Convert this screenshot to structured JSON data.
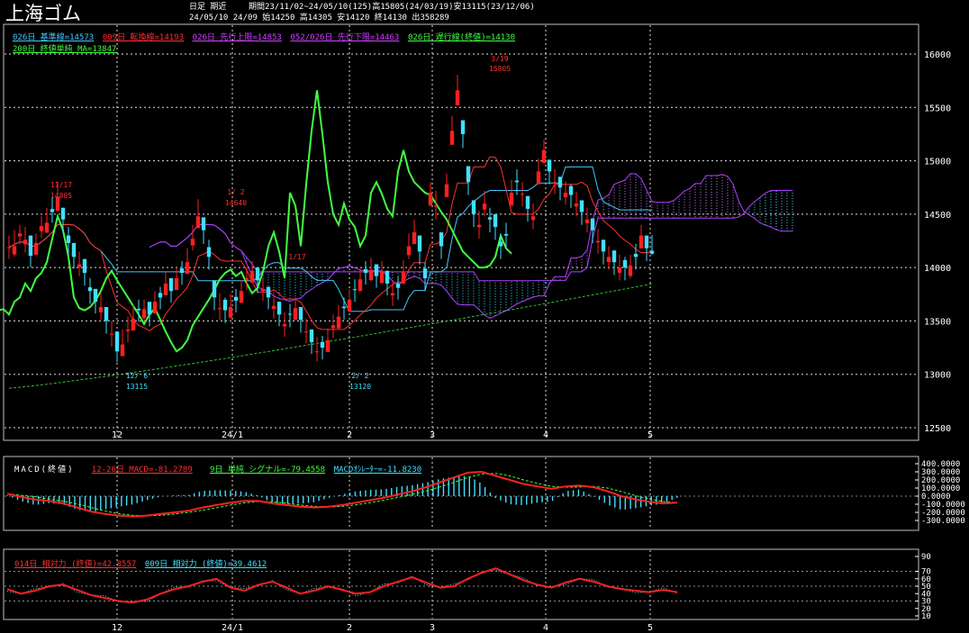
{
  "header": {
    "title": "上海ゴム",
    "mode": "日足 期近",
    "period_info": "期間23/11/02~24/05/10(125)高15805(24/03/19)安13115(23/12/06)",
    "last_bar": "24/05/10 24/09 始14250 高14305 安14120 終14130 出358289"
  },
  "legends": {
    "line1": [
      {
        "text": "026日 基準線=14573",
        "color": "#40c8ff"
      },
      {
        "text": "009日 転換線=14193",
        "color": "#ff3030"
      },
      {
        "text": "026日 先行上限=14853",
        "color": "#d040ff"
      },
      {
        "text": "052/026日 先行下限=14463",
        "color": "#d040ff"
      },
      {
        "text": "026日 遅行線(終値)=14130",
        "color": "#40ff40"
      }
    ],
    "line2": [
      {
        "text": "200日 終値単純 MA=13847",
        "color": "#40ff40"
      }
    ],
    "macd": [
      {
        "text": "MACD(終値)",
        "color": "#ffffff"
      },
      {
        "text": "12-26日 MACD=-81.2789",
        "color": "#ff3030"
      },
      {
        "text": "9日 単純 シグナル=-79.4558",
        "color": "#40ff40"
      },
      {
        "text": "MACDｵｼﾚｰﾀｰ=-11.8230",
        "color": "#40e0ff"
      }
    ],
    "rsi": [
      {
        "text": "014日 相対力 (終値)=42.8557",
        "color": "#ff3030"
      },
      {
        "text": "009日 相対力 (終値)=39.4612",
        "color": "#40e0ff"
      }
    ]
  },
  "annotations": [
    {
      "text": "11/17",
      "color": "#ff3030"
    },
    {
      "text": "14805",
      "color": "#ff3030"
    },
    {
      "text": "1/ 2",
      "color": "#ff3030"
    },
    {
      "text": "14640",
      "color": "#ff3030"
    },
    {
      "text": "1/17",
      "color": "#ff3030"
    },
    {
      "text": "3/19",
      "color": "#ff3030"
    },
    {
      "text": "15805",
      "color": "#ff3030"
    },
    {
      "text": "12/ 6",
      "color": "#40e0ff"
    },
    {
      "text": "13115",
      "color": "#40e0ff"
    },
    {
      "text": "2/ 2",
      "color": "#40e0ff"
    },
    {
      "text": "13120",
      "color": "#40e0ff"
    }
  ],
  "x_labels": [
    "12",
    "24/1",
    "2",
    "3",
    "4",
    "5"
  ],
  "y_labels_price": [
    "16000",
    "15500",
    "15000",
    "14500",
    "14000",
    "13500",
    "13000",
    "12500"
  ],
  "y_labels_macd": [
    "400.0000",
    "300.0000",
    "200.0000",
    "100.0000",
    "0.0000",
    "-100.0000",
    "-200.0000",
    "-300.0000"
  ],
  "y_labels_rsi": [
    "90",
    "70",
    "60",
    "50",
    "40",
    "30",
    "20",
    "10"
  ],
  "chart_data": [
    {
      "type": "candlestick",
      "title": "上海ゴム",
      "ylim": [
        12500,
        16000
      ],
      "x_range": [
        "23/11/02",
        "24/05/10"
      ],
      "trading_days": 125,
      "closes": [
        14190,
        14200,
        14320,
        14260,
        14110,
        14230,
        14390,
        14420,
        14520,
        14660,
        14450,
        14230,
        14100,
        14030,
        13950,
        13780,
        13680,
        13630,
        13500,
        13380,
        13215,
        13280,
        13420,
        13520,
        13600,
        13610,
        13560,
        13680,
        13720,
        13850,
        13780,
        13900,
        13950,
        14050,
        14270,
        14480,
        14350,
        14100,
        13720,
        13620,
        13600,
        13630,
        13690,
        13780,
        13900,
        13970,
        13880,
        13800,
        13720,
        13640,
        13560,
        13470,
        13560,
        13620,
        13510,
        13400,
        13300,
        13215,
        13250,
        13320,
        13460,
        13540,
        13620,
        13700,
        13790,
        13890,
        13950,
        13980,
        13920,
        13960,
        13850,
        13760,
        13810,
        13960,
        14200,
        14330,
        14150,
        13900,
        14700,
        14580,
        14200,
        14780,
        15280,
        15660,
        15250,
        14800,
        14500,
        14400,
        14600,
        14450,
        14380,
        14200,
        14300,
        14700,
        14800,
        14690,
        14550,
        14480,
        14900,
        15100,
        14900,
        14800,
        14750,
        14700,
        14680,
        14600,
        14520,
        14450,
        14350,
        14250,
        14150,
        14100,
        14050,
        14000,
        14000,
        14020,
        14100,
        14300,
        14180,
        14130
      ],
      "highs": [
        14300,
        14350,
        14400,
        14380,
        14300,
        14320,
        14480,
        14560,
        14660,
        14805,
        14560,
        14380,
        14230,
        14150,
        14080,
        13900,
        13800,
        13760,
        13630,
        13500,
        13400,
        13420,
        13540,
        13650,
        13700,
        13700,
        13680,
        13780,
        13820,
        13960,
        13900,
        14000,
        14060,
        14180,
        14400,
        14640,
        14470,
        14260,
        13880,
        13760,
        13720,
        13760,
        13800,
        13880,
        14000,
        14060,
        14000,
        13900,
        13820,
        13750,
        13680,
        13580,
        13660,
        13720,
        13630,
        13520,
        13420,
        13350,
        13360,
        13430,
        13560,
        13650,
        13720,
        13800,
        13890,
        13990,
        14060,
        14090,
        14030,
        14060,
        13970,
        13880,
        13920,
        14070,
        14320,
        14450,
        14300,
        14050,
        14800,
        14720,
        14330,
        14880,
        15420,
        15805,
        15380,
        14950,
        14630,
        14530,
        14720,
        14560,
        14500,
        14320,
        14420,
        14820,
        14920,
        14800,
        14670,
        14600,
        15020,
        15200,
        15010,
        14920,
        14850,
        14810,
        14780,
        14710,
        14630,
        14560,
        14460,
        14360,
        14260,
        14200,
        14160,
        14120,
        14100,
        14120,
        14220,
        14400,
        14300,
        14305
      ],
      "lows": [
        14080,
        14100,
        14220,
        14140,
        14000,
        14120,
        14280,
        14320,
        14420,
        14530,
        14320,
        14110,
        13990,
        13920,
        13830,
        13660,
        13570,
        13510,
        13380,
        13260,
        13115,
        13170,
        13300,
        13410,
        13490,
        13500,
        13450,
        13570,
        13610,
        13740,
        13670,
        13790,
        13840,
        13940,
        14160,
        14370,
        14220,
        13980,
        13600,
        13510,
        13480,
        13520,
        13580,
        13670,
        13790,
        13860,
        13760,
        13690,
        13610,
        13520,
        13450,
        13350,
        13440,
        13510,
        13390,
        13290,
        13190,
        13120,
        13140,
        13210,
        13340,
        13430,
        13510,
        13590,
        13680,
        13780,
        13840,
        13870,
        13810,
        13850,
        13740,
        13640,
        13700,
        13850,
        14080,
        14220,
        14030,
        13780,
        14580,
        14450,
        14080,
        14660,
        15150,
        15520,
        15120,
        14680,
        14380,
        14270,
        14480,
        14330,
        14260,
        14080,
        14180,
        14580,
        14680,
        14570,
        14430,
        14360,
        14780,
        14980,
        14780,
        14690,
        14630,
        14590,
        14560,
        14480,
        14400,
        14330,
        14230,
        14130,
        14030,
        13980,
        13930,
        13880,
        13880,
        13900,
        13980,
        14180,
        14060,
        14120
      ],
      "tenkan_last": 14193,
      "kijun_last": 14573,
      "senkou_a_last": 14853,
      "senkou_b_last": 14463,
      "chikou_last": 14130,
      "ma200_range": [
        12870,
        13847
      ]
    },
    {
      "type": "macd",
      "ylim": [
        -300,
        400
      ],
      "macd_last": -81.2789,
      "signal_last": -79.4558,
      "osc_last": -11.823,
      "macd_path": [
        30,
        -10,
        -40,
        -60,
        -90,
        -140,
        -190,
        -220,
        -240,
        -250,
        -240,
        -220,
        -200,
        -180,
        -140,
        -110,
        -80,
        -60,
        -60,
        -90,
        -110,
        -130,
        -140,
        -130,
        -110,
        -80,
        -50,
        -20,
        20,
        60,
        110,
        170,
        230,
        290,
        300,
        250,
        200,
        150,
        120,
        90,
        120,
        130,
        110,
        60,
        0,
        -40,
        -70,
        -90,
        -80
      ]
    },
    {
      "type": "rsi",
      "ylim": [
        10,
        90
      ],
      "rsi14_last": 42.8557,
      "rsi9_last": 39.4612,
      "rsi_path": [
        46,
        40,
        44,
        50,
        52,
        45,
        38,
        34,
        30,
        28,
        32,
        40,
        46,
        50,
        56,
        60,
        48,
        44,
        52,
        56,
        48,
        40,
        44,
        50,
        45,
        40,
        42,
        50,
        56,
        62,
        55,
        48,
        50,
        60,
        68,
        74,
        66,
        58,
        52,
        48,
        55,
        60,
        56,
        50,
        46,
        44,
        42,
        45,
        42
      ]
    }
  ]
}
